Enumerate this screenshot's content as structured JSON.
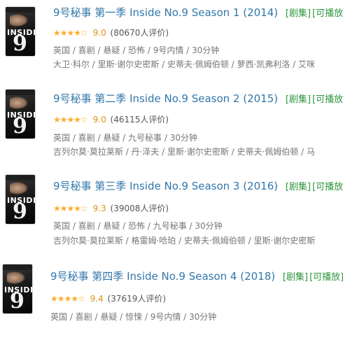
{
  "items": [
    {
      "title": "9号秘事 第一季 Inside No.9 Season 1 (2014)",
      "tag_type": "剧集",
      "tag_play": "可播放",
      "stars": "★★★★☆",
      "score": "9.0",
      "count": "(80670人评价)",
      "meta": "英国 / 喜剧 / 悬疑 / 恐怖 / 9号内情 / 30分钟",
      "cast": "大卫·科尔 / 里斯·谢尔史密斯 / 史蒂夫·佩姆伯顿 / 萝西·凯弗利洛 / 艾咪"
    },
    {
      "title": "9号秘事 第二季 Inside No.9 Season 2 (2015)",
      "tag_type": "剧集",
      "tag_play": "可播放",
      "stars": "★★★★☆",
      "score": "9.0",
      "count": "(46115人评价)",
      "meta": "英国 / 喜剧 / 悬疑 / 九号秘事 / 30分钟",
      "cast": "吉列尔莫·莫拉莱斯 / 丹·泽夫 / 里斯·谢尔史密斯 / 史蒂夫·佩姆伯顿 / 马"
    },
    {
      "title": "9号秘事 第三季 Inside No.9 Season 3 (2016)",
      "tag_type": "剧集",
      "tag_play": "可播放",
      "stars": "★★★★☆",
      "score": "9.3",
      "count": "(39008人评价)",
      "meta": "英国 / 喜剧 / 悬疑 / 恐怖 / 九号秘事 / 30分钟",
      "cast": "吉列尔莫·莫拉莱斯 / 格雷姆·哈珀 / 史蒂夫·佩姆伯顿 / 里斯·谢尔史密斯"
    },
    {
      "title": "9号秘事 第四季 Inside No.9 Season 4 (2018)",
      "tag_type": "剧集",
      "tag_play": "可播放",
      "stars": "★★★★☆",
      "score": "9.4",
      "count": "(37619人评价)",
      "meta": "英国 / 喜剧 / 悬疑 / 惊悚 / 9号内情 / 30分钟",
      "cast": ""
    }
  ],
  "cover_text": {
    "logo": "INSIDE",
    "number": "9"
  },
  "colors": {
    "link": "#3377aa",
    "tag": "#2e963d",
    "star": "#ffac2d",
    "meta": "#777777"
  }
}
